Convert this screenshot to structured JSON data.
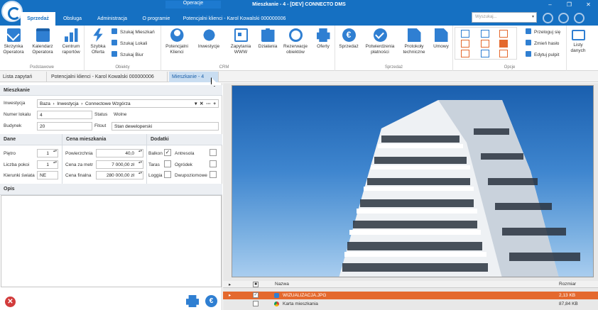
{
  "window": {
    "title": "Mieszkanie - 4 - [DEV] CONNECTO DMS",
    "context_tab": "Operacje",
    "controls": [
      "–",
      "❐",
      "✕"
    ]
  },
  "ribbon_tabs": [
    {
      "label": "Sprzedaż",
      "active": true
    },
    {
      "label": "Obsługa",
      "active": false
    },
    {
      "label": "Administracja",
      "active": false
    },
    {
      "label": "O programie",
      "active": false
    },
    {
      "label": "Potencjalni klienci - Karol Kowalski 000000006",
      "active": false
    }
  ],
  "search": {
    "placeholder": "Wyszukaj..."
  },
  "ribbon": {
    "groups": {
      "podstawowe": "Podstawowe",
      "obiekty": "Obiekty",
      "crm": "CRM",
      "sprzedaz": "Sprzedaż",
      "opcje": "Opcje"
    },
    "buttons": {
      "skrzynka": [
        "Skrzynka",
        "Operatora"
      ],
      "kalendarz": [
        "Kalendarz",
        "Operatora"
      ],
      "centrum": [
        "Centrum",
        "raportów"
      ],
      "szybka": [
        "Szybka",
        "Oferta"
      ],
      "szukaj_mieszkan": "Szukaj Mieszkań",
      "szukaj_lokali": "Szukaj Lokali",
      "szukaj_biur": "Szukaj Biur",
      "potencjalni": [
        "Potencjalni",
        "Klienci"
      ],
      "inwestycje": "Inwestycje",
      "zapytania": [
        "Zapytania",
        "WWW"
      ],
      "dzialania": "Działania",
      "rezerwacje": [
        "Rezerwacje",
        "obiektów"
      ],
      "oferty": "Oferty",
      "sprzedaz": "Sprzedaż",
      "potwierdzenia": [
        "Potwierdzenia",
        "płatności"
      ],
      "protokoly": [
        "Protokoły",
        "techniczne"
      ],
      "umowy": "Umowy",
      "przeloguj": "Przeloguj się",
      "zmien_haslo": "Zmień hasło",
      "edytuj_pulpit": "Edytuj pulpit",
      "listy_danych": [
        "Listy",
        "danych"
      ]
    }
  },
  "doc_tabs": [
    {
      "label": "Lista zapytań",
      "active": false
    },
    {
      "label": "Potencjalni klienci - Karol Kowalski 000000006",
      "active": false
    },
    {
      "label": "Mieszkanie - 4",
      "active": true
    }
  ],
  "form": {
    "section_title": "Mieszkanie",
    "inwestycja_label": "Inwestycja",
    "inwestycja_path": [
      "Baza",
      "Inwestycja",
      "Connectowe Wzgórza"
    ],
    "numer_lokalu_label": "Numer lokalu",
    "numer_lokalu": "4",
    "status_label": "Status",
    "status": "Wolne",
    "budynek_label": "Budynek",
    "budynek": "20",
    "fitout_label": "Fitout",
    "fitout": "Stan deweloperski",
    "dane": {
      "title": "Dane",
      "pietro_label": "Piętro",
      "pietro": "1",
      "liczba_pokoi_label": "Liczba pokoi",
      "liczba_pokoi": "1",
      "kierunki_label": "Kierunki świata",
      "kierunki": "NE"
    },
    "cena": {
      "title": "Cena mieszkania",
      "powierzchnia_label": "Powierzchnia",
      "powierzchnia": "40,0",
      "cena_za_metr_label": "Cena za metr",
      "cena_za_metr": "7 000,00 zł",
      "cena_finalna_label": "Cena finalna",
      "cena_finalna": "280 000,00 zł"
    },
    "dodatki": {
      "title": "Dodatki",
      "balkon": "Balkon",
      "balkon_checked": true,
      "antresola": "Antresola",
      "antresola_checked": false,
      "taras": "Taras",
      "taras_checked": false,
      "ogrodek": "Ogródek",
      "ogrodek_checked": false,
      "loggia": "Loggia",
      "loggia_checked": false,
      "dwupoziomowe": "Dwupoziomowe",
      "dwupoziomowe_checked": false
    },
    "opis_title": "Opis"
  },
  "files": {
    "header_name": "Nazwa",
    "header_size": "Rozmiar",
    "rows": [
      {
        "name": "WIZUALIZACJA.JPG",
        "size": "2,13 KB",
        "checked": true,
        "selected": true
      },
      {
        "name": "Karta mieszkania",
        "size": "87,84 KB",
        "checked": false,
        "selected": false
      }
    ]
  },
  "colors": {
    "accent": "#1570c2",
    "selection": "#e4692e",
    "cancel": "#d23c3c"
  }
}
